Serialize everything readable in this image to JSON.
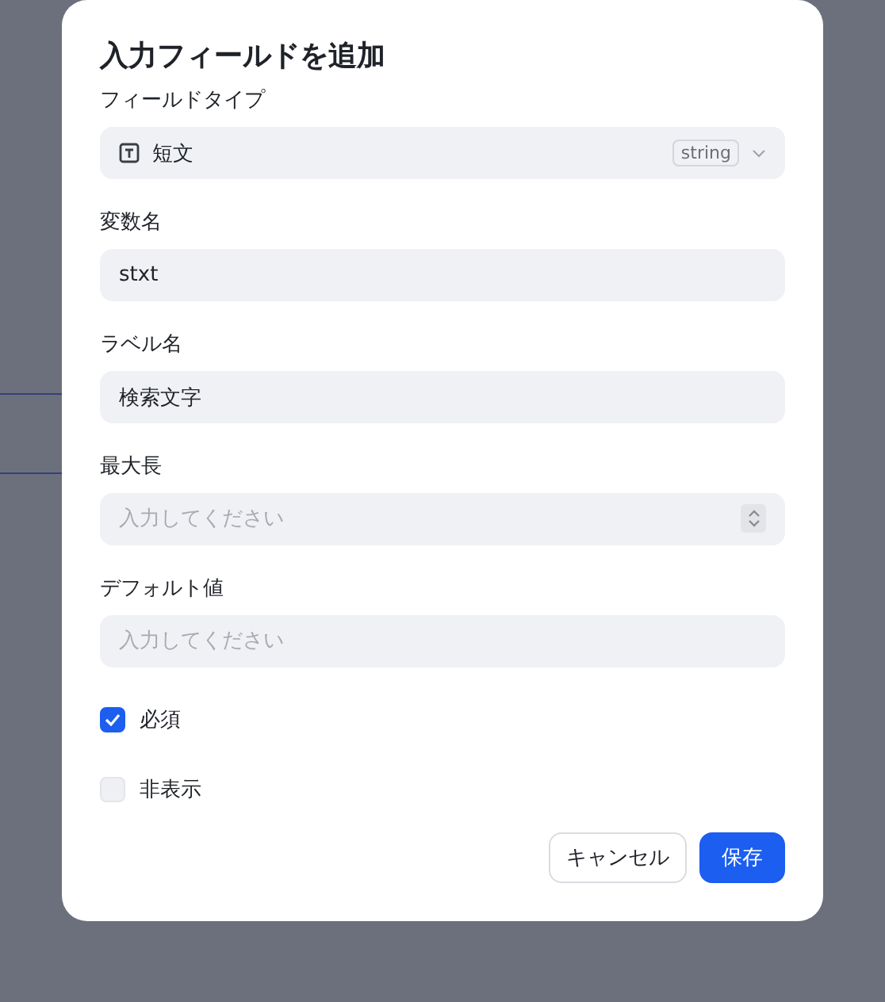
{
  "dialog": {
    "title": "入力フィールドを追加",
    "fields": [
      {
        "kind": "select",
        "label": "フィールドタイプ",
        "value": "短文",
        "tag": "string"
      },
      {
        "kind": "text",
        "label": "変数名",
        "value": "stxt"
      },
      {
        "kind": "text",
        "label": "ラベル名",
        "value": "検索文字"
      },
      {
        "kind": "number",
        "label": "最大長",
        "placeholder": "入力してください"
      },
      {
        "kind": "text",
        "label": "デフォルト値",
        "placeholder": "入力してください"
      }
    ],
    "options": [
      {
        "label": "必須",
        "checked": true
      },
      {
        "label": "非表示",
        "checked": false
      }
    ],
    "buttons": [
      {
        "label": "キャンセル",
        "kind": "secondary"
      },
      {
        "label": "保存",
        "kind": "primary"
      }
    ]
  }
}
